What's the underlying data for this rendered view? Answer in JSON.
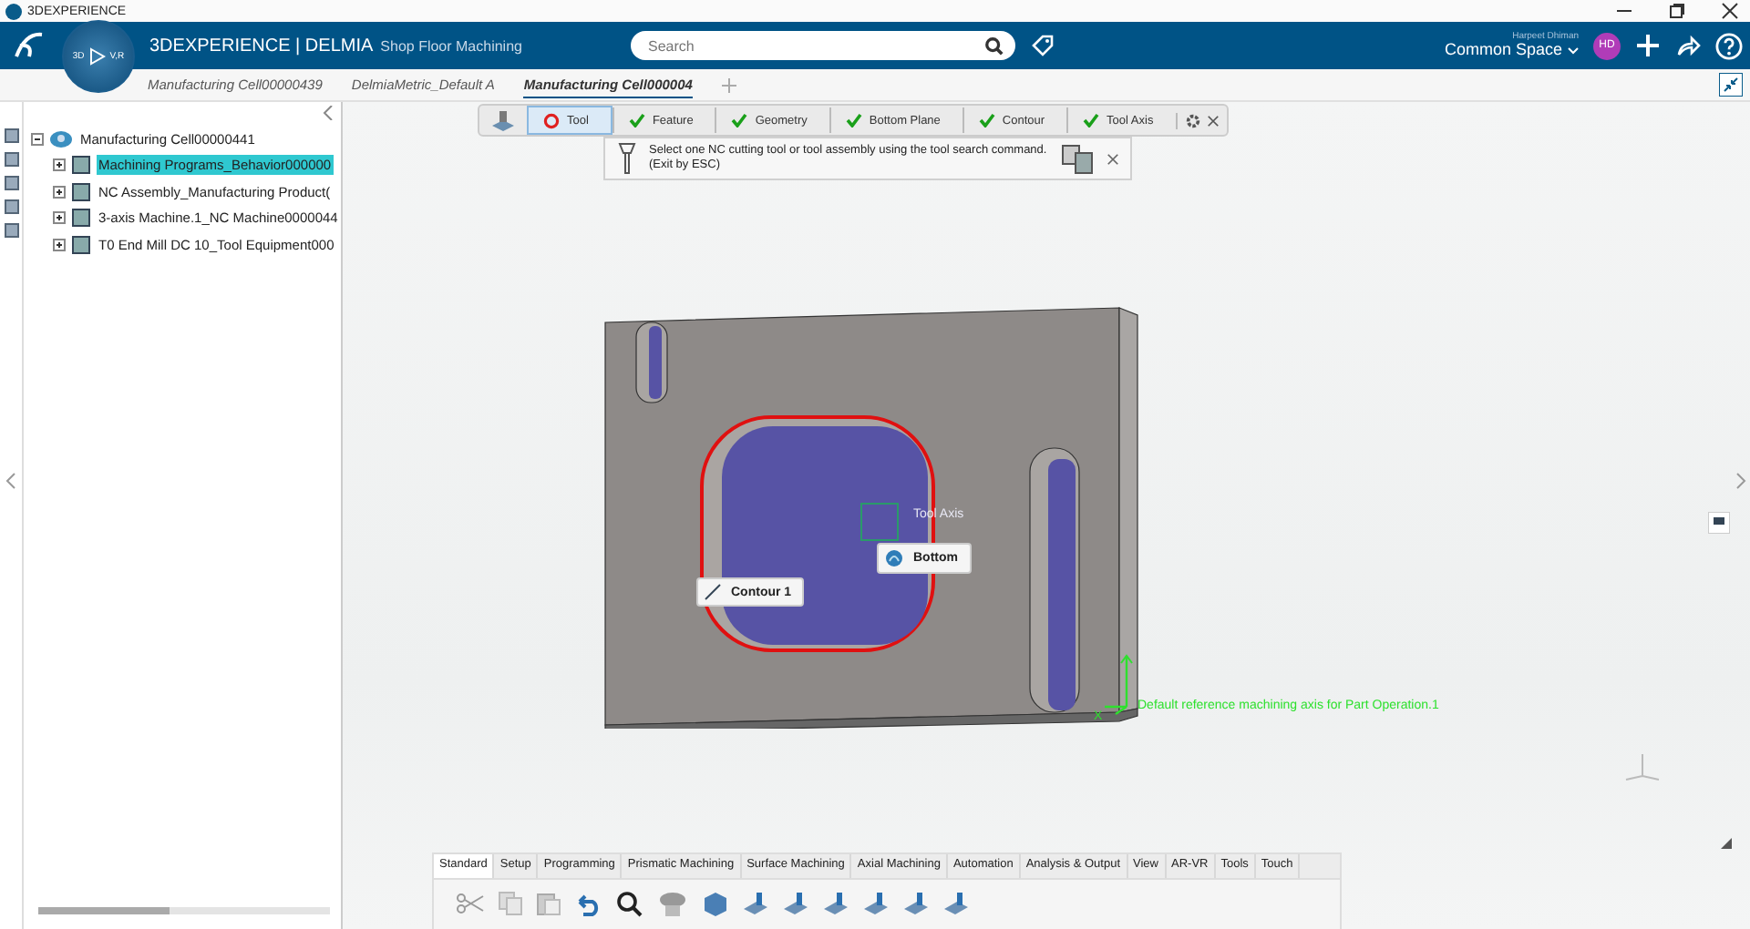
{
  "window": {
    "title": "3DEXPERIENCE"
  },
  "header": {
    "compass_labels": [
      "3D",
      "V,R"
    ],
    "brand": "**3D**EXPERIENCE | **DELMIA**",
    "app": "Shop Floor Machining",
    "search": {
      "placeholder": "Search"
    },
    "user": "Harpeet Dhiman",
    "space": "Common Space",
    "avatar": "HD"
  },
  "doc_tabs": [
    {
      "label": "Manufacturing Cell00000439",
      "selected": false
    },
    {
      "label": "DelmiaMetric_Default A",
      "selected": false
    },
    {
      "label": "Manufacturing Cell000004",
      "selected": true
    }
  ],
  "tree": {
    "label": "Manufacturing Cell00000441",
    "expanded": true,
    "children": [
      {
        "label": "Machining Programs_Behavior000000",
        "selected": true,
        "expanded": false
      },
      {
        "label": "NC Assembly_Manufacturing Product(",
        "selected": false,
        "expanded": false
      },
      {
        "label": "3-axis Machine.1_NC Machine0000044",
        "selected": false,
        "expanded": false
      },
      {
        "label": "T0 End Mill DC 10_Tool Equipment000",
        "selected": false,
        "expanded": false
      }
    ]
  },
  "wizard": {
    "steps": [
      {
        "label": "Tool",
        "selected": true,
        "done": false
      },
      {
        "label": "Feature",
        "selected": false,
        "done": true
      },
      {
        "label": "Geometry",
        "selected": false,
        "done": true
      },
      {
        "label": "Bottom Plane",
        "selected": false,
        "done": true
      },
      {
        "label": "Contour",
        "selected": false,
        "done": true
      },
      {
        "label": "Tool Axis",
        "selected": false,
        "done": true
      }
    ]
  },
  "message": {
    "text": "Select one NC cutting tool or tool assembly using the tool search command.",
    "hint": "(Exit by ESC)"
  },
  "viewport": {
    "tool_axis": "Tool Axis",
    "bottom": "Bottom",
    "contour": "Contour 1",
    "axis_letter": "X",
    "axis_caption": "Default reference machining axis for Part Operation.1"
  },
  "ribbon": {
    "tabs": [
      {
        "label": "Standard",
        "selected": true
      },
      {
        "label": "Setup",
        "selected": false
      },
      {
        "label": "Programming",
        "selected": false
      },
      {
        "label": "Prismatic Machining",
        "selected": false
      },
      {
        "label": "Surface Machining",
        "selected": false
      },
      {
        "label": "Axial Machining",
        "selected": false
      },
      {
        "label": "Automation",
        "selected": false
      },
      {
        "label": "Analysis & Output",
        "selected": false
      },
      {
        "label": "View",
        "selected": false
      },
      {
        "label": "AR-VR",
        "selected": false
      },
      {
        "label": "Tools",
        "selected": false
      },
      {
        "label": "Touch",
        "selected": false
      }
    ]
  }
}
